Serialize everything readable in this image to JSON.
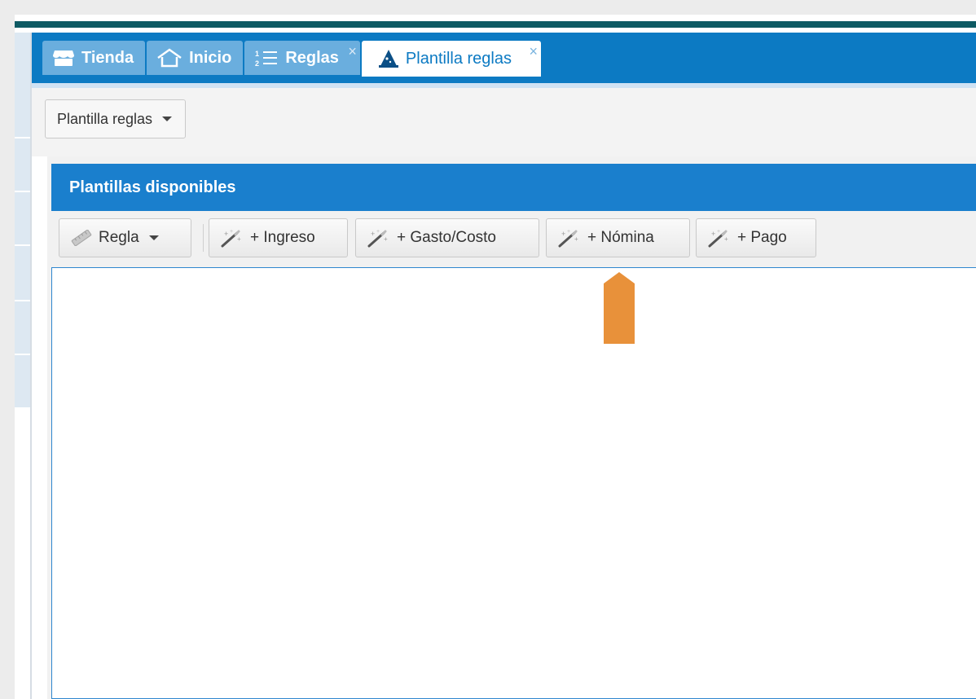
{
  "tabs": [
    {
      "label": "Tienda",
      "icon": "store-icon",
      "closable": false,
      "active": false
    },
    {
      "label": "Inicio",
      "icon": "home-icon",
      "closable": false,
      "active": false
    },
    {
      "label": "Reglas",
      "icon": "numbered-list-icon",
      "closable": true,
      "active": false
    },
    {
      "label": "Plantilla reglas",
      "icon": "wizard-hat-icon",
      "closable": true,
      "active": true
    }
  ],
  "close_glyph": "×",
  "selector": {
    "label": "Plantilla reglas",
    "icon": "chevron-down-icon"
  },
  "panel": {
    "title": "Plantillas disponibles"
  },
  "toolbar": {
    "regla_label": "Regla",
    "ingreso_label": "+ Ingreso",
    "gasto_label": "+ Gasto/Costo",
    "nomina_label": "+ Nómina",
    "pago_label": "+ Pago"
  },
  "colors": {
    "tab_bar": "#0c7ac3",
    "tab_inactive": "#6aaede",
    "panel_header": "#1a7fcd",
    "top_line": "#0e5a63",
    "annotation_arrow": "#e8913a"
  }
}
